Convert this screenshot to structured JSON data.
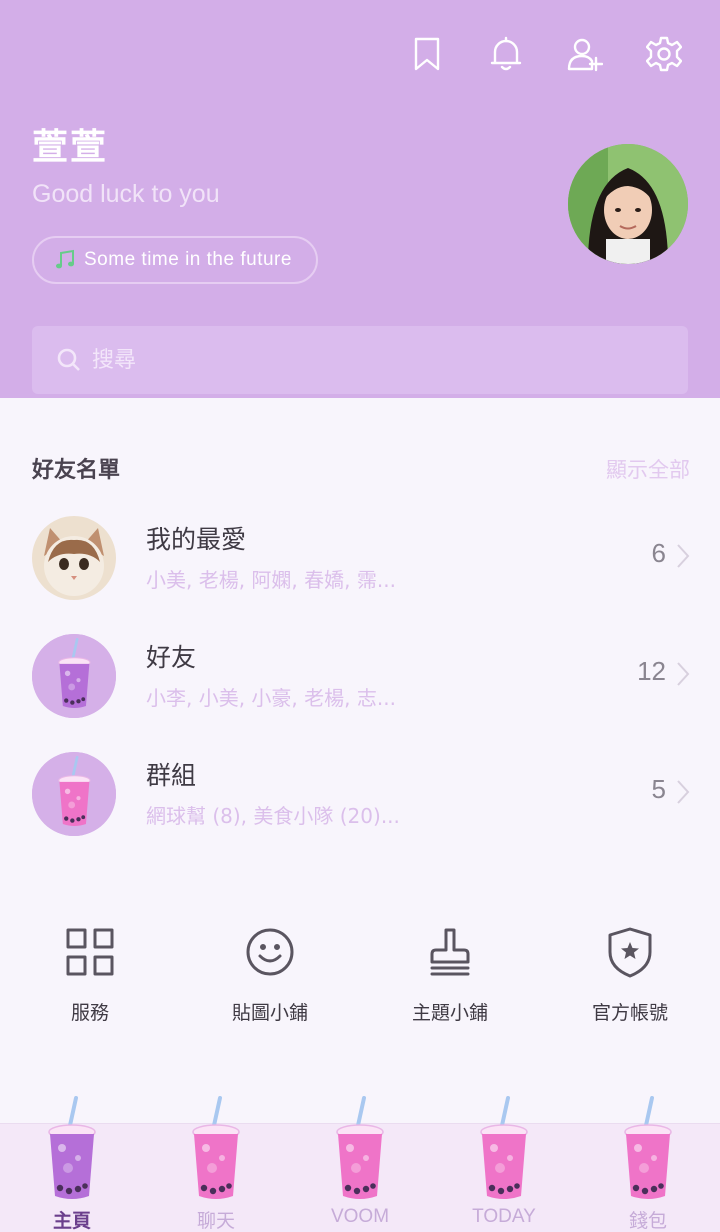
{
  "header": {
    "icons": [
      "bookmark-icon",
      "bell-icon",
      "add-friend-icon",
      "gear-icon"
    ],
    "profile_name": "萱萱",
    "status_message": "Good luck to you",
    "music": "Some time in the future",
    "search_placeholder": "搜尋"
  },
  "friends": {
    "title": "好友名單",
    "show_all": "顯示全部",
    "rows": [
      {
        "title": "我的最愛",
        "subtitle": "小美, 老楊, 阿嫻, 春嬌, 霈...",
        "count": "6"
      },
      {
        "title": "好友",
        "subtitle": "小李, 小美, 小豪, 老楊, 志...",
        "count": "12"
      },
      {
        "title": "群組",
        "subtitle": "網球幫 (8), 美食小隊 (20)...",
        "count": "5"
      }
    ]
  },
  "services": [
    {
      "label": "服務",
      "icon": "grid-icon"
    },
    {
      "label": "貼圖小鋪",
      "icon": "smiley-icon"
    },
    {
      "label": "主題小鋪",
      "icon": "paint-brush-icon"
    },
    {
      "label": "官方帳號",
      "icon": "shield-star-icon"
    }
  ],
  "nav": {
    "tabs": [
      {
        "label": "主頁",
        "active": true
      },
      {
        "label": "聊天"
      },
      {
        "label": "VOOM"
      },
      {
        "label": "TODAY"
      },
      {
        "label": "錢包"
      }
    ]
  },
  "colors": {
    "header_bg": "#d3aee8",
    "accent": "#6b3f8c",
    "subtitle": "#dbbfeb",
    "background": "#f8f5fc"
  }
}
